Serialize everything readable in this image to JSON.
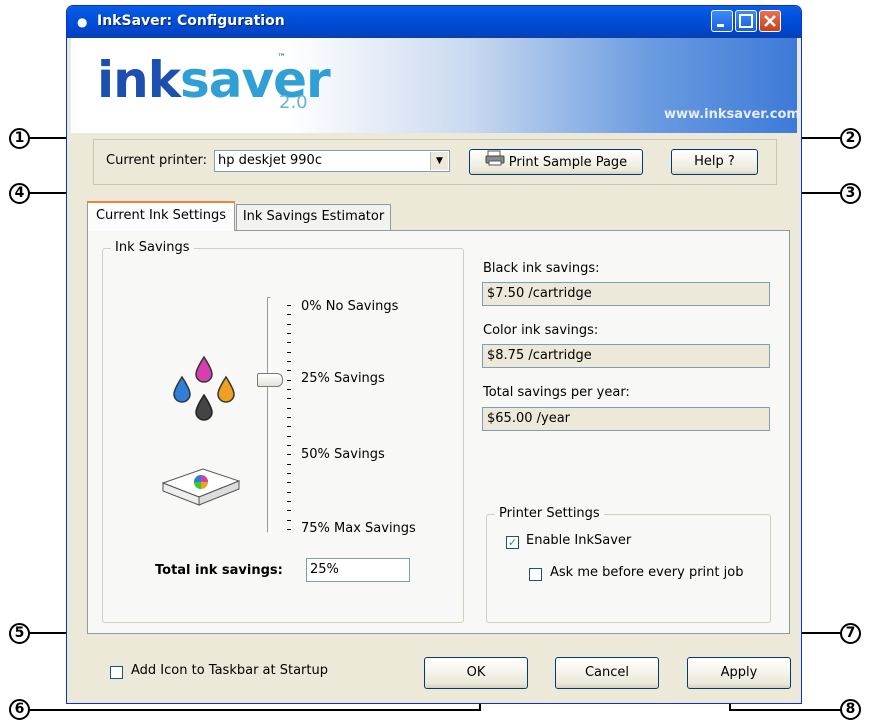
{
  "window": {
    "title": "InkSaver: Configuration",
    "app_icon": "ink-drop-icon"
  },
  "banner": {
    "logo_ink": "ink",
    "logo_saver": "saver",
    "logo_tm": "™",
    "logo_version": "2.0",
    "website": "www.inksaver.com"
  },
  "printer": {
    "label": "Current printer:",
    "value": "hp deskjet 990c",
    "print_sample_label": "Print Sample Page",
    "help_label": "Help ?"
  },
  "tabs": [
    {
      "label": "Current Ink Settings"
    },
    {
      "label": "Ink Savings Estimator"
    }
  ],
  "ink_savings": {
    "group_title": "Ink Savings",
    "levels": [
      "0% No Savings",
      "25% Savings",
      "50% Savings",
      "75% Max Savings"
    ],
    "slider_value_percent": 25,
    "total_label": "Total ink savings:",
    "total_value": "25%"
  },
  "savings": {
    "black_label": "Black ink savings:",
    "black_value": "$7.50 /cartridge",
    "color_label": "Color ink savings:",
    "color_value": "$8.75 /cartridge",
    "total_label": "Total savings per year:",
    "total_value": "$65.00 /year"
  },
  "printer_settings": {
    "group_title": "Printer Settings",
    "enable_label": "Enable InkSaver",
    "enable_checked": true,
    "ask_label": "Ask me before every print job",
    "ask_checked": false
  },
  "bottom": {
    "taskbar_label": "Add Icon to Taskbar at Startup",
    "taskbar_checked": false,
    "ok_label": "OK",
    "cancel_label": "Cancel",
    "apply_label": "Apply"
  },
  "callouts": [
    "1",
    "2",
    "3",
    "4",
    "5",
    "6",
    "7",
    "8"
  ],
  "colors": {
    "titlebar": "#0050dd",
    "logo_ink": "#1c4fb0",
    "logo_saver": "#2f9fd6",
    "drop_magenta": "#d63fb0",
    "drop_cyan": "#2d7fd8",
    "drop_yellow": "#f0a020",
    "drop_black": "#333333"
  }
}
